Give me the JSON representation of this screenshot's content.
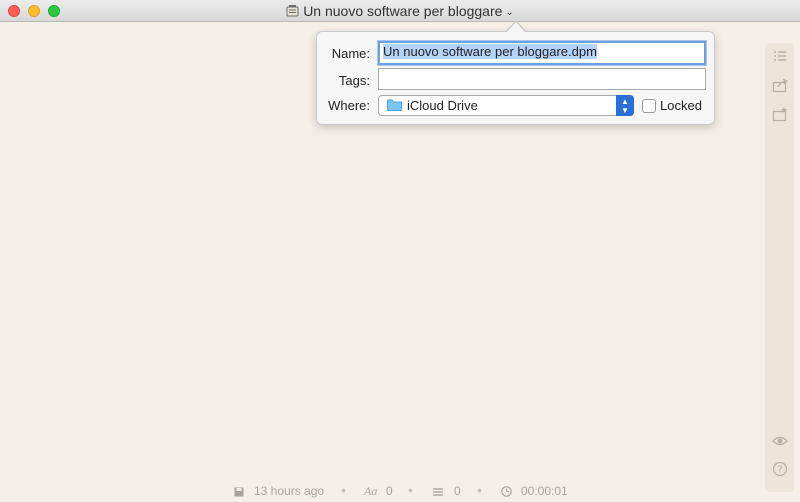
{
  "window": {
    "title": "Un nuovo software per bloggare"
  },
  "save_popover": {
    "name_label": "Name:",
    "name_value": "Un nuovo software per bloggare.dpm",
    "tags_label": "Tags:",
    "tags_value": "",
    "where_label": "Where:",
    "where_value": "iCloud Drive",
    "locked_label": "Locked",
    "locked_checked": false
  },
  "sidebar": {
    "icons": [
      "outline-list-icon",
      "share-icon",
      "export-star-icon",
      "preview-eye-icon",
      "help-icon"
    ]
  },
  "statusbar": {
    "saved": "13 hours ago",
    "characters": "0",
    "words": "0",
    "time": "00:00:01"
  },
  "colors": {
    "background": "#f5f0e7",
    "accent": "#2a6fd6",
    "selection": "#b3d3fb"
  }
}
